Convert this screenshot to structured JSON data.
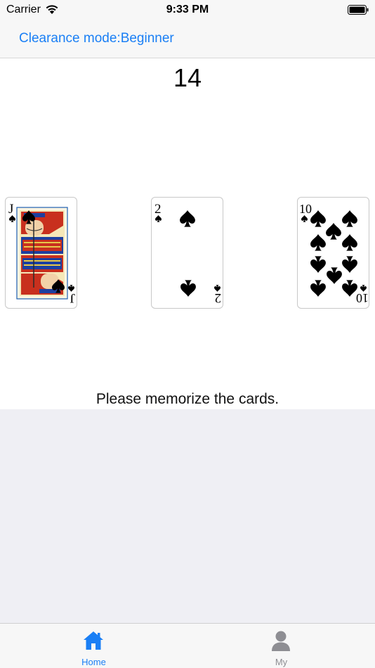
{
  "status_bar": {
    "carrier": "Carrier",
    "time": "9:33 PM"
  },
  "nav": {
    "title": "Clearance mode:Beginner"
  },
  "game": {
    "timer": "14",
    "instruction": "Please memorize the cards.",
    "cards": [
      {
        "rank": "J",
        "suit": "spade"
      },
      {
        "rank": "2",
        "suit": "spade"
      },
      {
        "rank": "10",
        "suit": "spade"
      }
    ]
  },
  "tabs": [
    {
      "label": "Home",
      "icon": "home-icon",
      "active": true
    },
    {
      "label": "My",
      "icon": "person-icon",
      "active": false
    }
  ],
  "colors": {
    "accent": "#1a7ff5",
    "inactive": "#8e8e93",
    "background": "#efeff4"
  }
}
